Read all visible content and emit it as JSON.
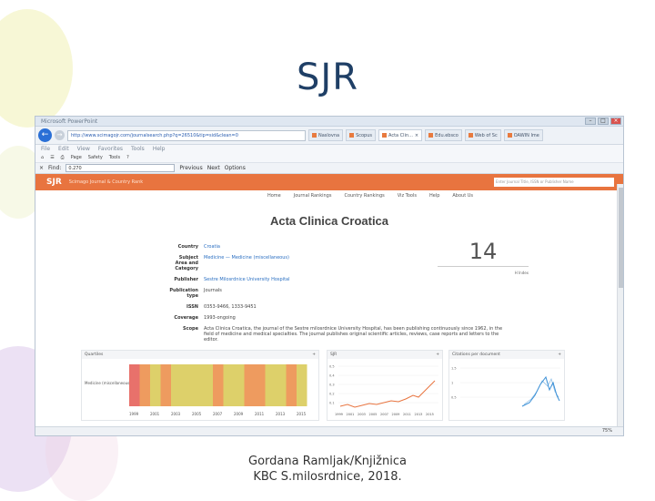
{
  "slide": {
    "title": "SJR",
    "footer_line1": "Gordana Ramljak/Knjižnica",
    "footer_line2": "KBC S.milosrdnice, 2018."
  },
  "browser": {
    "address": "http://www.scimagojr.com/journalsearch.php?q=26510&tip=sid&clean=0",
    "tabs": [
      "Naslovna",
      "Scopus",
      "Acta Clin...",
      "Edu.ebsco",
      "Web of Sc",
      "OAWIN Ime"
    ],
    "menu": [
      "File",
      "Edit",
      "View",
      "Favorites",
      "Tools",
      "Help"
    ],
    "commands": [
      "Page",
      "Safety",
      "Tools"
    ],
    "find_label": "Find:",
    "find_value": "0.270",
    "find_previous": "Previous",
    "find_next": "Next",
    "find_options": "Options",
    "zoom": "75%"
  },
  "sjr_site": {
    "logo": "SJR",
    "tagline": "Scimago Journal & Country Rank",
    "search_placeholder": "Enter Journal Title, ISSN or Publisher Name",
    "nav": [
      "Home",
      "Journal Rankings",
      "Country Rankings",
      "Viz Tools",
      "Help",
      "About Us"
    ]
  },
  "journal": {
    "title": "Acta Clinica Croatica",
    "h_index": "14",
    "h_index_label": "H Index",
    "fields": [
      {
        "label": "Country",
        "value": "Croatia"
      },
      {
        "label": "Subject Area and Category",
        "value": "Medicine — Medicine (miscellaneous)"
      },
      {
        "label": "Publisher",
        "value": "Sestre Milosrdnice University Hospital"
      },
      {
        "label": "Publication type",
        "value": "Journals"
      },
      {
        "label": "ISSN",
        "value": "0353-9466, 1333-9451"
      },
      {
        "label": "Coverage",
        "value": "1993-ongoing"
      },
      {
        "label": "Scope",
        "value": "Acta Clinica Croatica, the journal of the Sestre milosrdnice University Hospital, has been publishing continuously since 1962, in the field of medicine and medical specialties. The journal publishes original scientific articles, reviews, case reports and letters to the editor."
      }
    ]
  },
  "widgets": {
    "quartiles_title": "Quartiles",
    "quartiles_category": "Medicine (miscellaneous)",
    "quartiles_years": [
      "1999",
      "2001",
      "2003",
      "2005",
      "2007",
      "2009",
      "2011",
      "2013",
      "2015"
    ],
    "sjr_title": "SJR",
    "sjr_years": [
      "1999",
      "2001",
      "2003",
      "2005",
      "2007",
      "2009",
      "2011",
      "2013",
      "2015"
    ],
    "sjr_yticks": [
      "0.5",
      "0.4",
      "0.3",
      "0.2",
      "0.1"
    ],
    "citations_title": "Citations per document",
    "citations_yticks": [
      "1.5",
      "1",
      "0.5"
    ],
    "colors": {
      "q4": "#e8716b",
      "q3": "#ee9b5f",
      "q2": "#ddd06a",
      "q1": "#a6c45f",
      "sjr_line": "#e8743f",
      "cites_line": "#3a8fd6"
    }
  }
}
